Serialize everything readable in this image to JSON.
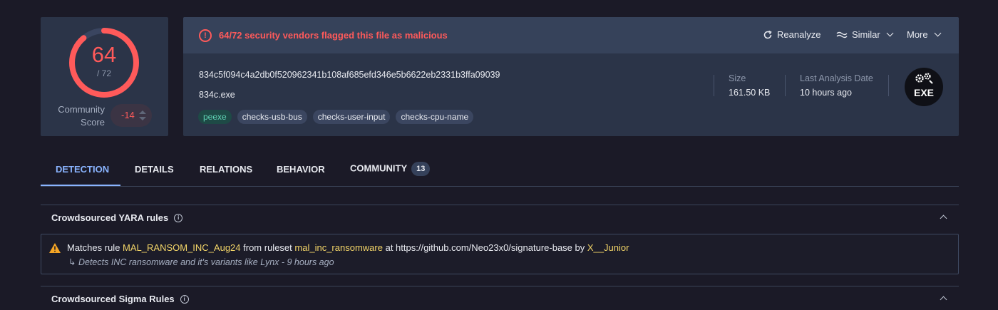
{
  "score": {
    "detections": "64",
    "total": "/ 72",
    "detection_ratio": 0.8889,
    "community_label_1": "Community",
    "community_label_2": "Score",
    "community_value": "-14"
  },
  "alert": {
    "icon": "alert-circle-icon",
    "text": "64/72 security vendors flagged this file as malicious"
  },
  "actions": {
    "reanalyze": "Reanalyze",
    "similar": "Similar",
    "more": "More"
  },
  "file": {
    "hash": "834c5f094c4a2db0f520962341b108af685efd346e5b6622eb2331b3ffa09039",
    "name": "834c.exe",
    "tags": [
      "peexe",
      "checks-usb-bus",
      "checks-user-input",
      "checks-cpu-name"
    ],
    "size_label": "Size",
    "size_value": "161.50 KB",
    "analysis_label": "Last Analysis Date",
    "analysis_value": "10 hours ago",
    "type_badge": "EXE"
  },
  "tabs": [
    {
      "label": "DETECTION",
      "active": true
    },
    {
      "label": "DETAILS"
    },
    {
      "label": "RELATIONS"
    },
    {
      "label": "BEHAVIOR"
    },
    {
      "label": "COMMUNITY",
      "badge": "13"
    }
  ],
  "sections": {
    "yara_title": "Crowdsourced YARA rules",
    "sigma_title": "Crowdsourced Sigma Rules"
  },
  "yara": {
    "prefix": "Matches rule",
    "rule": "MAL_RANSOM_INC_Aug24",
    "ruleset_prefix": "from ruleset",
    "ruleset": "mal_inc_ransomware",
    "source_prefix": "at https://github.com/Neo23x0/signature-base by",
    "author": "X__Junior",
    "arrow": "↳",
    "description": "Detects INC ransomware and it's variants like Lynx - 9 hours ago"
  },
  "colors": {
    "background": "#1b1a27",
    "card": "#2b3448",
    "danger": "#ff5a5a",
    "accent": "#8ab4ff",
    "highlight": "#f3d568"
  }
}
